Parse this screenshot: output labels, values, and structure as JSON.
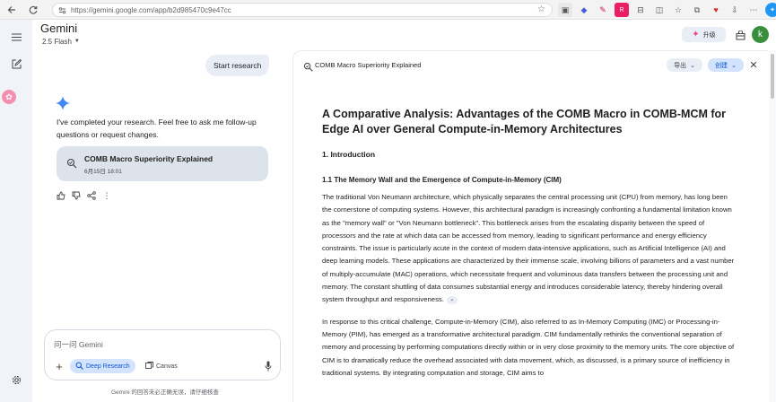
{
  "browser": {
    "url": "https://gemini.google.com/app/b2d985470c9e47cc"
  },
  "header": {
    "app_title": "Gemini",
    "model": "2.5 Flash",
    "upgrade_label": "升级",
    "avatar_letter": "k"
  },
  "chat": {
    "user_message": "Start research",
    "bot_message": "I've completed your research. Feel free to ask me follow-up questions or request changes.",
    "research_card": {
      "title": "COMB Macro Superiority Explained",
      "date": "6月15日 18:01"
    }
  },
  "input": {
    "placeholder": "问一问 Gemini",
    "deep_research_label": "Deep Research",
    "canvas_label": "Canvas"
  },
  "disclaimer": "Gemini 的回答未必正确无误，请仔细核查",
  "document": {
    "header_title": "COMB Macro Superiority Explained",
    "export_label": "导出",
    "create_label": "创建",
    "title": "A Comparative Analysis: Advantages of the COMB Macro in COMB-MCM for Edge AI over General Compute-in-Memory Architectures",
    "section1": "1. Introduction",
    "section1_1": "1.1 The Memory Wall and the Emergence of Compute-in-Memory (CIM)",
    "para1": "The traditional Von Neumann architecture, which physically separates the central processing unit (CPU) from memory, has long been the cornerstone of computing systems. However, this architectural paradigm is increasingly confronting a fundamental limitation known as the \"memory wall\" or \"Von Neumann bottleneck\". This bottleneck arises from the escalating disparity between the speed of processors and the rate at which data can be accessed from memory, leading to significant performance and energy efficiency constraints. The issue is particularly acute in the context of modern data-intensive applications, such as Artificial Intelligence (AI) and deep learning models. These applications are characterized by their immense scale, involving billions of parameters and a vast number of multiply-accumulate (MAC) operations, which necessitate frequent and voluminous data transfers between the processing unit and memory. The constant shuttling of data consumes substantial energy and introduces considerable latency, thereby hindering overall system throughput and responsiveness.",
    "para2": "In response to this critical challenge, Compute-in-Memory (CIM), also referred to as In-Memory Computing (IMC) or Processing-in-Memory (PIM), has emerged as a transformative architectural paradigm. CIM fundamentally rethinks the conventional separation of memory and processing by performing computations directly within or in very close proximity to the memory units. The core objective of CIM is to dramatically reduce the overhead associated with data movement, which, as discussed, is a primary source of inefficiency in traditional systems. By integrating computation and storage, CIM aims to"
  }
}
